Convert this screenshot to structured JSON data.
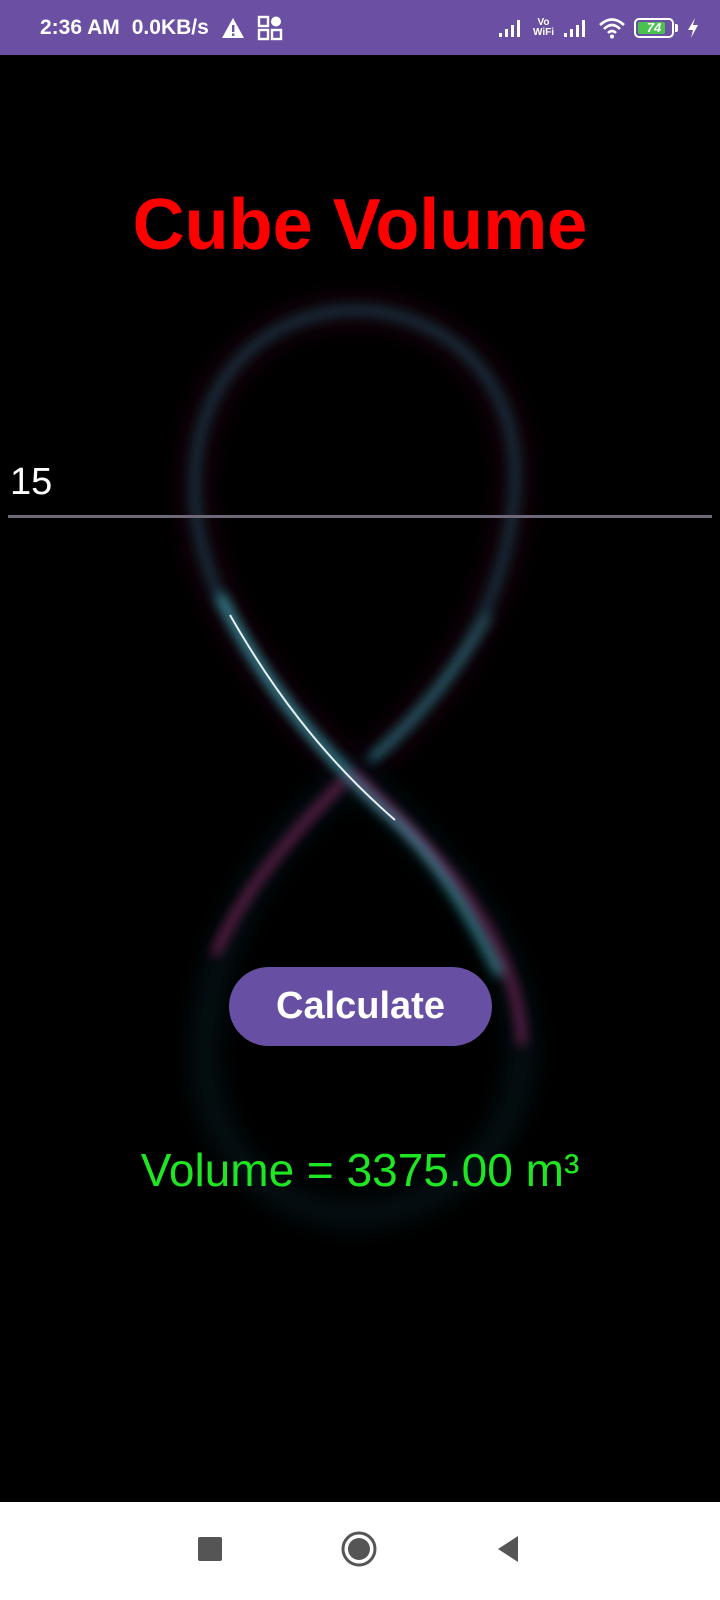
{
  "status_bar": {
    "time": "2:36 AM",
    "network_speed": "0.0KB/s",
    "alert_icon": "warning-icon",
    "app_icon": "apps-icon",
    "vowifi_top": "Vo",
    "vowifi_bottom": "WiFi",
    "battery_level": "74",
    "icons": [
      "signal-icon",
      "vowifi-icon",
      "signal-icon",
      "wifi-icon",
      "battery-icon",
      "charging-icon"
    ]
  },
  "app": {
    "title": "Cube Volume",
    "input_value": "15",
    "button_label": "Calculate",
    "result_text": "Volume = 3375.00 m³",
    "colors": {
      "title": "#ff0000",
      "result": "#1ee622",
      "button": "#6750a4",
      "status_bar": "#6b4fa3"
    }
  },
  "nav_bar": {
    "icons": [
      "recents-icon",
      "home-icon",
      "back-icon"
    ]
  }
}
